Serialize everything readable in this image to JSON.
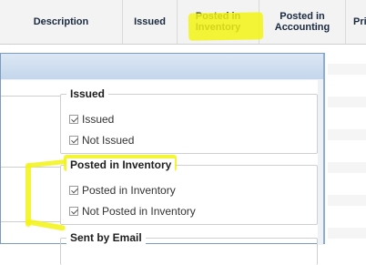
{
  "grid": {
    "columns": [
      {
        "label": "Description"
      },
      {
        "label": "Issued"
      },
      {
        "label": "Posted in\nInventory"
      },
      {
        "label": "Posted in\nAccounting"
      },
      {
        "label": "Pri"
      }
    ]
  },
  "filter_panel": {
    "groups": [
      {
        "title": "Issued",
        "options": [
          {
            "label": "Issued",
            "checked": true
          },
          {
            "label": "Not Issued",
            "checked": true
          }
        ]
      },
      {
        "title": "Posted in Inventory",
        "options": [
          {
            "label": "Posted in Inventory",
            "checked": true
          },
          {
            "label": "Not Posted in Inventory",
            "checked": true
          }
        ]
      },
      {
        "title": "Sent by Email",
        "options": []
      }
    ]
  },
  "annotation": {
    "highlight_color": "#f3f314"
  }
}
